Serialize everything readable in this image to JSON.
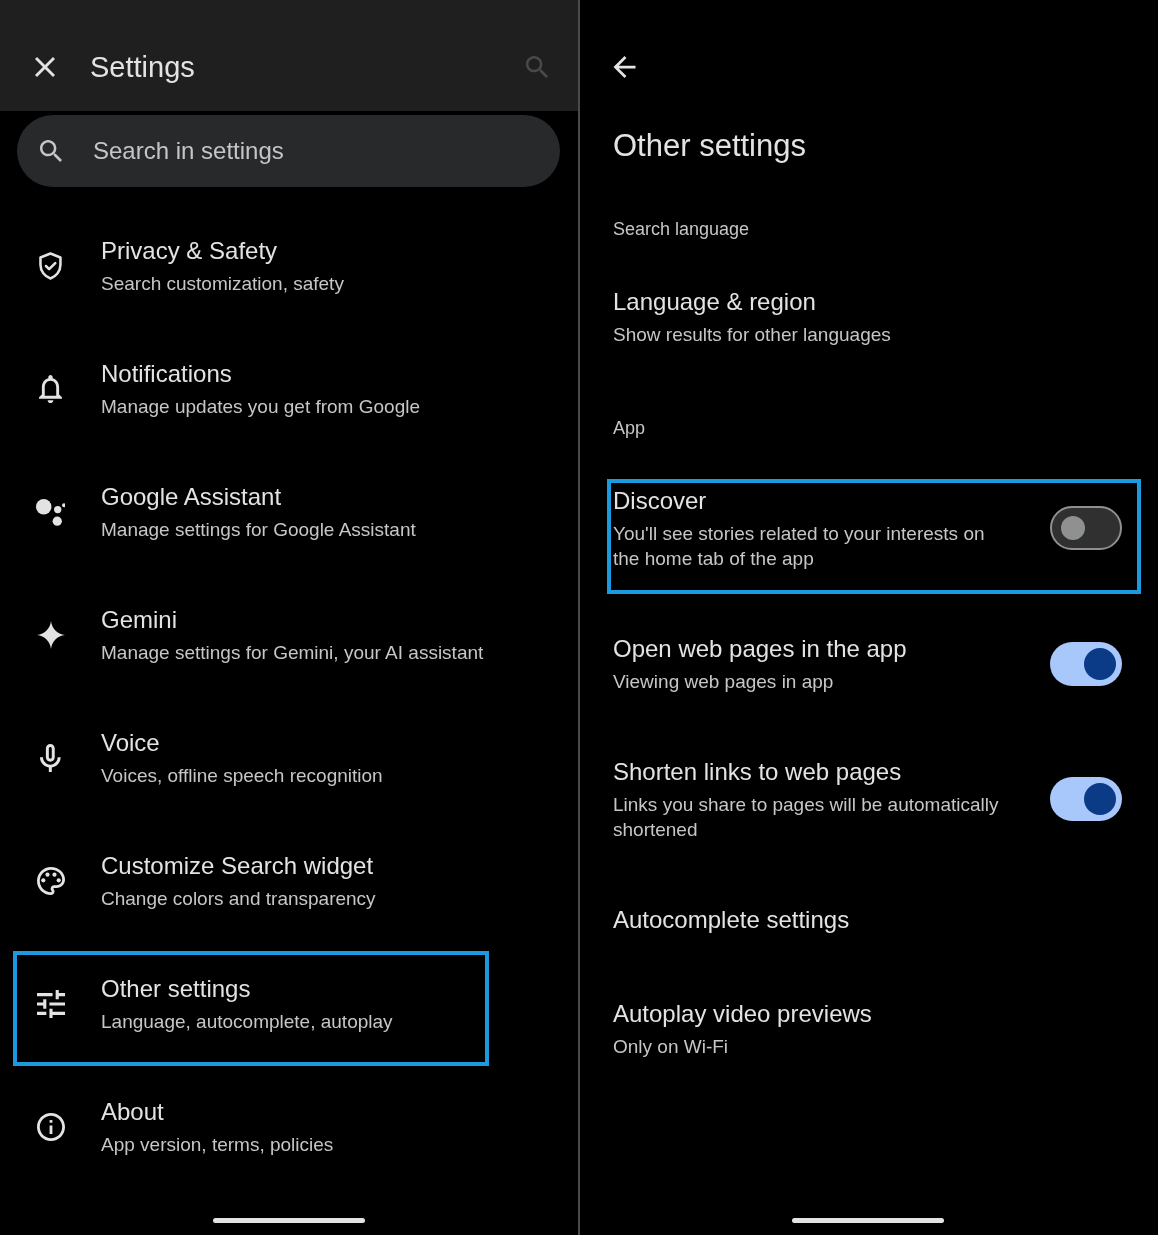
{
  "settings_panel": {
    "title": "Settings",
    "search_action": {
      "disabled": true
    },
    "search": {
      "placeholder": "Search in settings"
    },
    "items": [
      {
        "title": "Privacy & Safety",
        "subtitle": "Search customization, safety",
        "highlighted": false
      },
      {
        "title": "Notifications",
        "subtitle": "Manage updates you get from Google",
        "highlighted": false
      },
      {
        "title": "Google Assistant",
        "subtitle": "Manage settings for Google Assistant",
        "highlighted": false
      },
      {
        "title": "Gemini",
        "subtitle": "Manage settings for Gemini, your AI assistant",
        "highlighted": false
      },
      {
        "title": "Voice",
        "subtitle": "Voices, offline speech recognition",
        "highlighted": false
      },
      {
        "title": "Customize Search widget",
        "subtitle": "Change colors and transparency",
        "highlighted": false
      },
      {
        "title": "Other settings",
        "subtitle": "Language, autocomplete, autoplay",
        "highlighted": true
      },
      {
        "title": "About",
        "subtitle": "App version, terms, policies",
        "highlighted": false
      }
    ]
  },
  "other_settings_panel": {
    "title": "Other settings",
    "sections": [
      {
        "header": "Search language",
        "items": [
          {
            "kind": "link",
            "title": "Language & region",
            "subtitle": "Show results for other languages",
            "highlighted": false
          }
        ]
      },
      {
        "header": "App",
        "items": [
          {
            "kind": "toggle",
            "title": "Discover",
            "subtitle": "You'll see stories related to your interests on the home tab of the app",
            "on": false,
            "highlighted": true
          },
          {
            "kind": "toggle",
            "title": "Open web pages in the app",
            "subtitle": "Viewing web pages in app",
            "on": true,
            "highlighted": false
          },
          {
            "kind": "toggle",
            "title": "Shorten links to web pages",
            "subtitle": "Links you share to pages will be automatically shortened",
            "on": true,
            "highlighted": false
          },
          {
            "kind": "link",
            "title": "Autocomplete settings",
            "highlighted": false
          },
          {
            "kind": "link",
            "title": "Autoplay video previews",
            "subtitle": "Only on Wi-Fi",
            "highlighted": false
          }
        ]
      }
    ]
  }
}
